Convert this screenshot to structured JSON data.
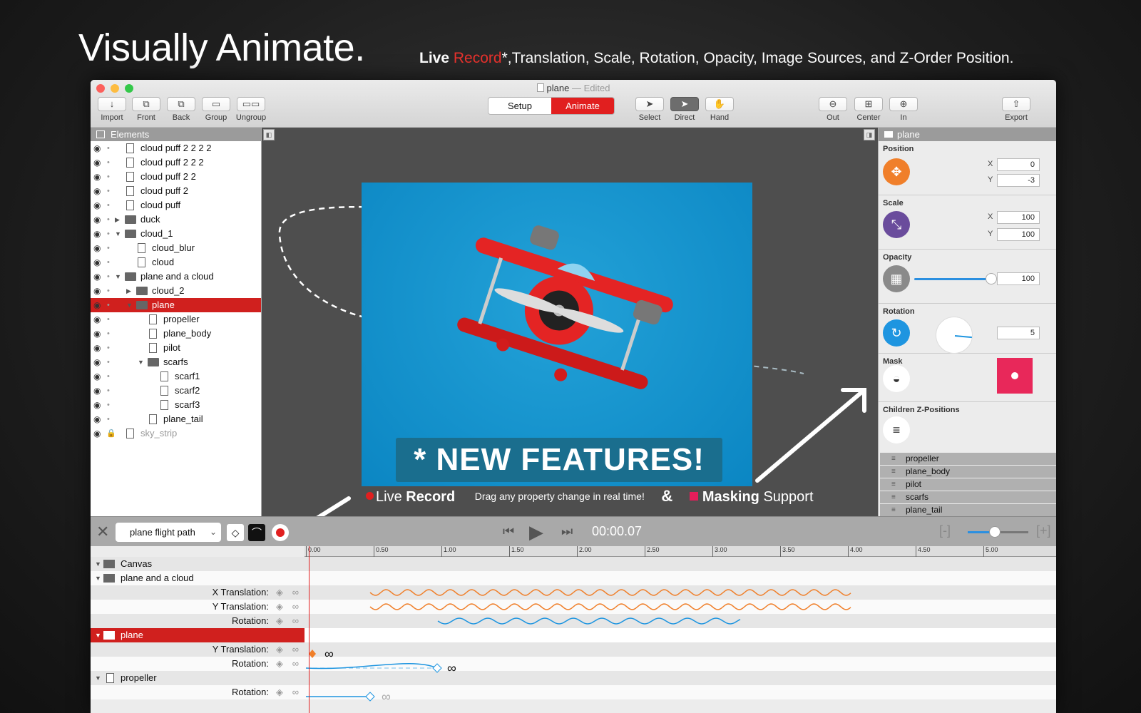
{
  "hero": {
    "title": "Visually Animate.",
    "subtitle_live": "Live",
    "subtitle_record": "Record",
    "subtitle_rest": "*,Translation, Scale, Rotation, Opacity, Image Sources, and Z-Order Position."
  },
  "window": {
    "doc_title": "plane",
    "edited": "— Edited"
  },
  "toolbar": {
    "import": "Import",
    "front": "Front",
    "back": "Back",
    "group": "Group",
    "ungroup": "Ungroup",
    "setup": "Setup",
    "animate": "Animate",
    "select": "Select",
    "direct": "Direct",
    "hand": "Hand",
    "out": "Out",
    "center": "Center",
    "in": "In",
    "export": "Export"
  },
  "elements_panel": {
    "title": "Elements",
    "items": [
      {
        "name": "cloud puff 2 2 2 2",
        "kind": "page",
        "indent": 0
      },
      {
        "name": "cloud puff 2 2 2",
        "kind": "page",
        "indent": 0
      },
      {
        "name": "cloud puff 2 2",
        "kind": "page",
        "indent": 0
      },
      {
        "name": "cloud puff 2",
        "kind": "page",
        "indent": 0
      },
      {
        "name": "cloud puff",
        "kind": "page",
        "indent": 0
      },
      {
        "name": "duck",
        "kind": "folder",
        "indent": 0,
        "expanded": false
      },
      {
        "name": "cloud_1",
        "kind": "folder",
        "indent": 0,
        "expanded": true
      },
      {
        "name": "cloud_blur",
        "kind": "page",
        "indent": 1
      },
      {
        "name": "cloud",
        "kind": "page",
        "indent": 1
      },
      {
        "name": "plane and a cloud",
        "kind": "folder",
        "indent": 0,
        "expanded": true
      },
      {
        "name": "cloud_2",
        "kind": "folder",
        "indent": 1,
        "expanded": false
      },
      {
        "name": "plane",
        "kind": "folder",
        "indent": 1,
        "expanded": true,
        "selected": true
      },
      {
        "name": "propeller",
        "kind": "page",
        "indent": 2
      },
      {
        "name": "plane_body",
        "kind": "page",
        "indent": 2
      },
      {
        "name": "pilot",
        "kind": "page",
        "indent": 2
      },
      {
        "name": "scarfs",
        "kind": "folder",
        "indent": 2,
        "expanded": true
      },
      {
        "name": "scarf1",
        "kind": "page",
        "indent": 3
      },
      {
        "name": "scarf2",
        "kind": "page",
        "indent": 3
      },
      {
        "name": "scarf3",
        "kind": "page",
        "indent": 3
      },
      {
        "name": "plane_tail",
        "kind": "page",
        "indent": 2
      },
      {
        "name": "sky_strip",
        "kind": "page",
        "indent": 0,
        "locked": true,
        "dim": true
      }
    ]
  },
  "canvas": {
    "banner": "* NEW FEATURES!",
    "caption_live": "Live",
    "caption_record": "Record",
    "caption_drag": "Drag any property change in real time!",
    "caption_amp": "&",
    "caption_masking": "Masking",
    "caption_support": "Support"
  },
  "inspector": {
    "title": "plane",
    "position_label": "Position",
    "pos_x": "0",
    "pos_y": "-3",
    "scale_label": "Scale",
    "scale_x": "100",
    "scale_y": "100",
    "opacity_label": "Opacity",
    "opacity_value": "100",
    "opacity_fraction": 1.0,
    "rotation_label": "Rotation",
    "rotation_value": "5",
    "mask_label": "Mask",
    "children_label": "Children Z-Positions",
    "axis_x": "X",
    "axis_y": "Y",
    "children": [
      "propeller",
      "plane_body",
      "pilot",
      "scarfs",
      "plane_tail"
    ],
    "colors": {
      "position": "#f07f2a",
      "scale": "#6a4c9c",
      "opacity": "#8a8a8a",
      "rotation": "#1e95e0",
      "mask_swatch": "#e8285a"
    }
  },
  "timeline": {
    "path_name": "plane flight path",
    "time": "00:00.07",
    "zoom_fraction": 0.45,
    "ruler": [
      "0.00",
      "0.50",
      "1.00",
      "1.50",
      "2.00",
      "2.50",
      "3.00",
      "3.50",
      "4.00",
      "4.50",
      "5.00"
    ],
    "tracks": [
      {
        "label": "Canvas",
        "kind": "group",
        "indent": 0
      },
      {
        "label": "plane and a cloud",
        "kind": "group",
        "indent": 0
      },
      {
        "label": "X Translation:",
        "kind": "prop"
      },
      {
        "label": "Y Translation:",
        "kind": "prop"
      },
      {
        "label": "Rotation:",
        "kind": "prop"
      },
      {
        "label": "plane",
        "kind": "group",
        "indent": 0,
        "selected": true
      },
      {
        "label": "Y Translation:",
        "kind": "prop"
      },
      {
        "label": "Rotation:",
        "kind": "prop"
      },
      {
        "label": "propeller",
        "kind": "page",
        "indent": 0
      },
      {
        "label": "Rotation:",
        "kind": "prop"
      }
    ]
  }
}
